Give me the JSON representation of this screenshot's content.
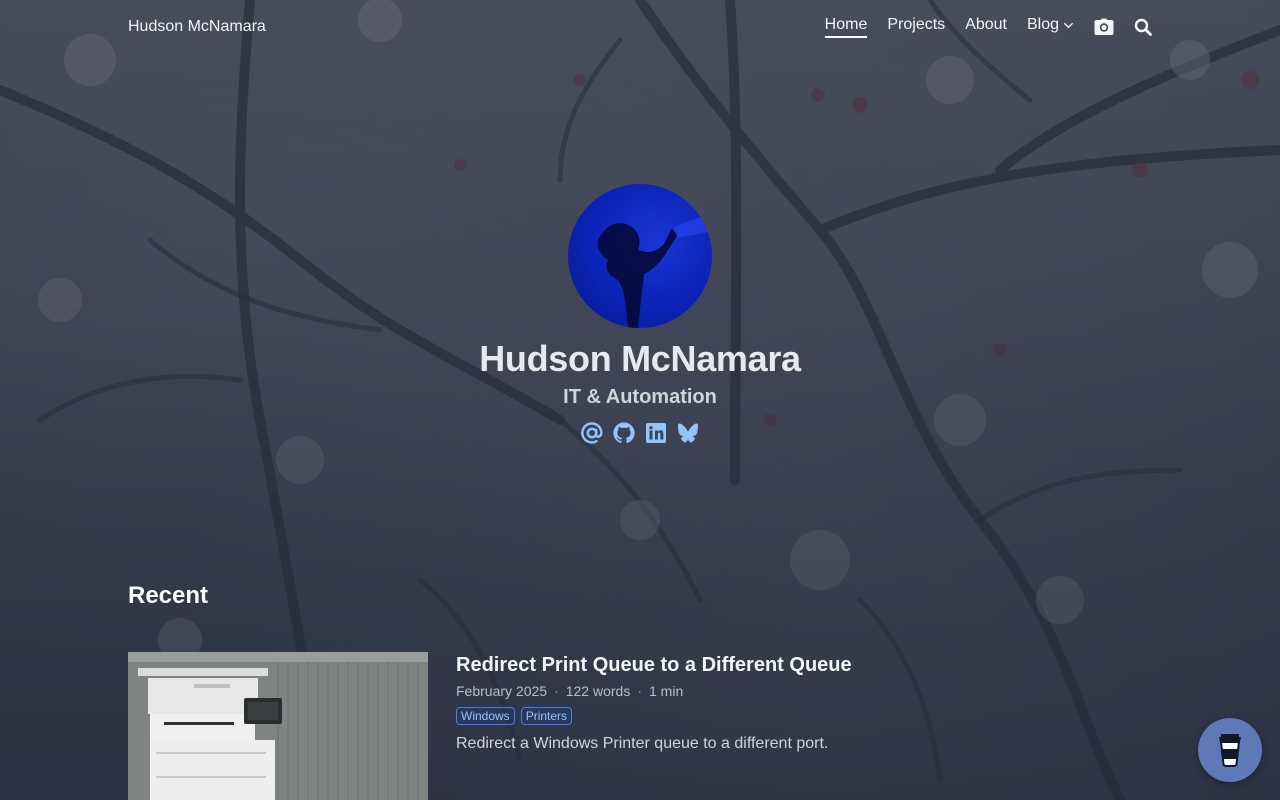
{
  "site": {
    "title": "Hudson McNamara"
  },
  "nav": {
    "items": [
      {
        "label": "Home",
        "active": true
      },
      {
        "label": "Projects"
      },
      {
        "label": "About"
      },
      {
        "label": "Blog",
        "has_dropdown": true
      }
    ],
    "icons": [
      "camera-icon",
      "search-icon"
    ]
  },
  "hero": {
    "name": "Hudson McNamara",
    "subtitle": "IT & Automation",
    "socials": [
      "email-icon",
      "github-icon",
      "linkedin-icon",
      "bluesky-icon"
    ]
  },
  "recent": {
    "heading": "Recent",
    "posts": [
      {
        "title": "Redirect Print Queue to a Different Queue",
        "date": "February 2025",
        "words": "122 words",
        "read_time": "1 min",
        "tags": [
          "Windows",
          "Printers"
        ],
        "summary": "Redirect a Windows Printer queue to a different port."
      }
    ]
  },
  "colors": {
    "accent": "#3b82f6",
    "tag_text": "#93c5fd",
    "coffee_button": "#5f78b8",
    "avatar": "#0b22b5"
  },
  "floating": {
    "icon": "coffee-cup-icon"
  }
}
